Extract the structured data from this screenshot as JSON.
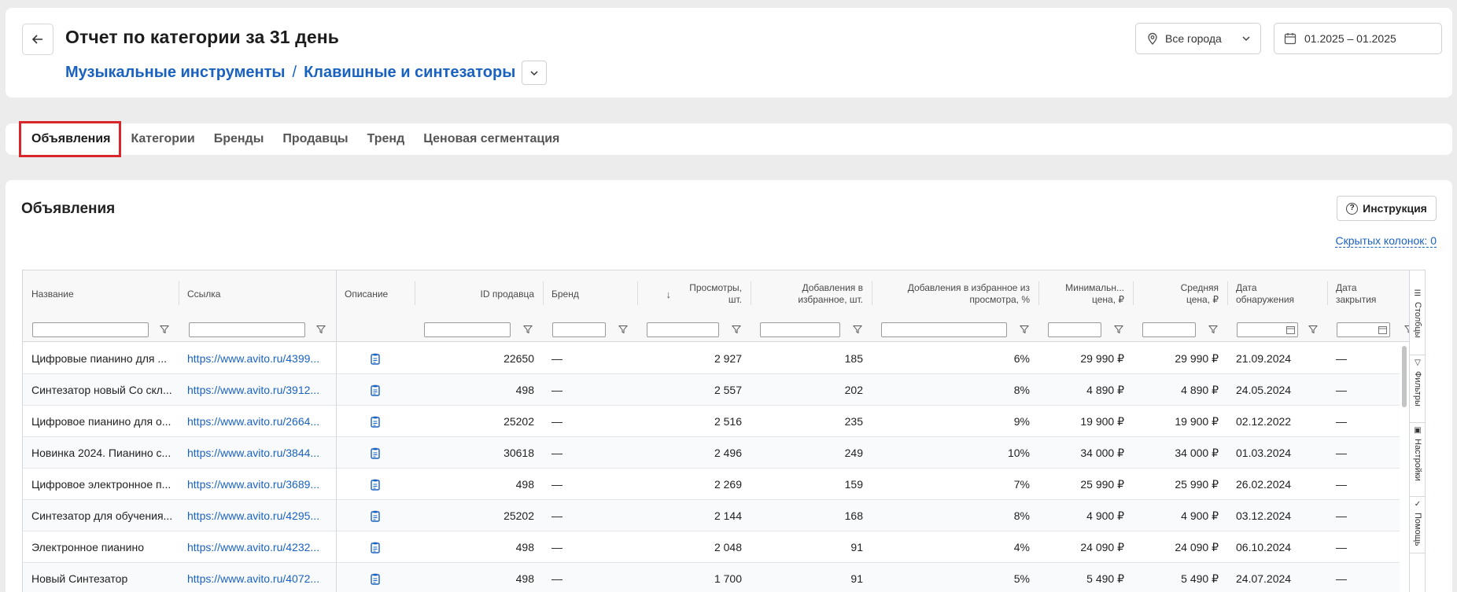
{
  "header": {
    "title": "Отчет по категории за 31 день",
    "breadcrumb": [
      "Музыкальные инструменты",
      "Клавишные и синтезаторы"
    ],
    "breadcrumb_sep": "/",
    "city": "Все города",
    "date_range": "01.2025 – 01.2025"
  },
  "tabs": [
    "Объявления",
    "Категории",
    "Бренды",
    "Продавцы",
    "Тренд",
    "Ценовая сегментация"
  ],
  "active_tab": "Объявления",
  "section": {
    "title": "Объявления",
    "help_label": "Инструкция",
    "hidden_columns": "Скрытых колонок: 0"
  },
  "columns": [
    "Название",
    "Ссылка",
    "Описание",
    "ID продавца",
    "Бренд",
    "Просмотры, шт.",
    "Добавления в избранное, шт.",
    "Добавления в избранное из просмотра, %",
    "Минимальн... цена, ₽",
    "Средняя цена, ₽",
    "Дата обнаружения",
    "Дата закрытия"
  ],
  "sort_indicator": "↓",
  "side_tabs": [
    "Столбцы",
    "Фильтры",
    "Настройки",
    "Помощь"
  ],
  "rows": [
    [
      "Цифровые пианино для ...",
      "https://www.avito.ru/4399...",
      "22650",
      "—",
      "2 927",
      "185",
      "6%",
      "29 990 ₽",
      "29 990 ₽",
      "21.09.2024",
      "—"
    ],
    [
      "Синтезатор новый Со скл...",
      "https://www.avito.ru/3912...",
      "498",
      "—",
      "2 557",
      "202",
      "8%",
      "4 890 ₽",
      "4 890 ₽",
      "24.05.2024",
      "—"
    ],
    [
      "Цифровое пианино для о...",
      "https://www.avito.ru/2664...",
      "25202",
      "—",
      "2 516",
      "235",
      "9%",
      "19 900 ₽",
      "19 900 ₽",
      "02.12.2022",
      "—"
    ],
    [
      "Новинка 2024. Пианино с...",
      "https://www.avito.ru/3844...",
      "30618",
      "—",
      "2 496",
      "249",
      "10%",
      "34 000 ₽",
      "34 000 ₽",
      "01.03.2024",
      "—"
    ],
    [
      "Цифровое электронное п...",
      "https://www.avito.ru/3689...",
      "498",
      "—",
      "2 269",
      "159",
      "7%",
      "25 990 ₽",
      "25 990 ₽",
      "26.02.2024",
      "—"
    ],
    [
      "Синтезатор для обучения...",
      "https://www.avito.ru/4295...",
      "25202",
      "—",
      "2 144",
      "168",
      "8%",
      "4 900 ₽",
      "4 900 ₽",
      "03.12.2024",
      "—"
    ],
    [
      "Электронное пианино",
      "https://www.avito.ru/4232...",
      "498",
      "—",
      "2 048",
      "91",
      "4%",
      "24 090 ₽",
      "24 090 ₽",
      "06.10.2024",
      "—"
    ],
    [
      "Новый Синтезатор",
      "https://www.avito.ru/4072...",
      "498",
      "—",
      "1 700",
      "91",
      "5%",
      "5 490 ₽",
      "5 490 ₽",
      "24.07.2024",
      "—"
    ]
  ],
  "colors": {
    "accent": "#1a62c0",
    "active_tab_border": "#d9262b"
  }
}
